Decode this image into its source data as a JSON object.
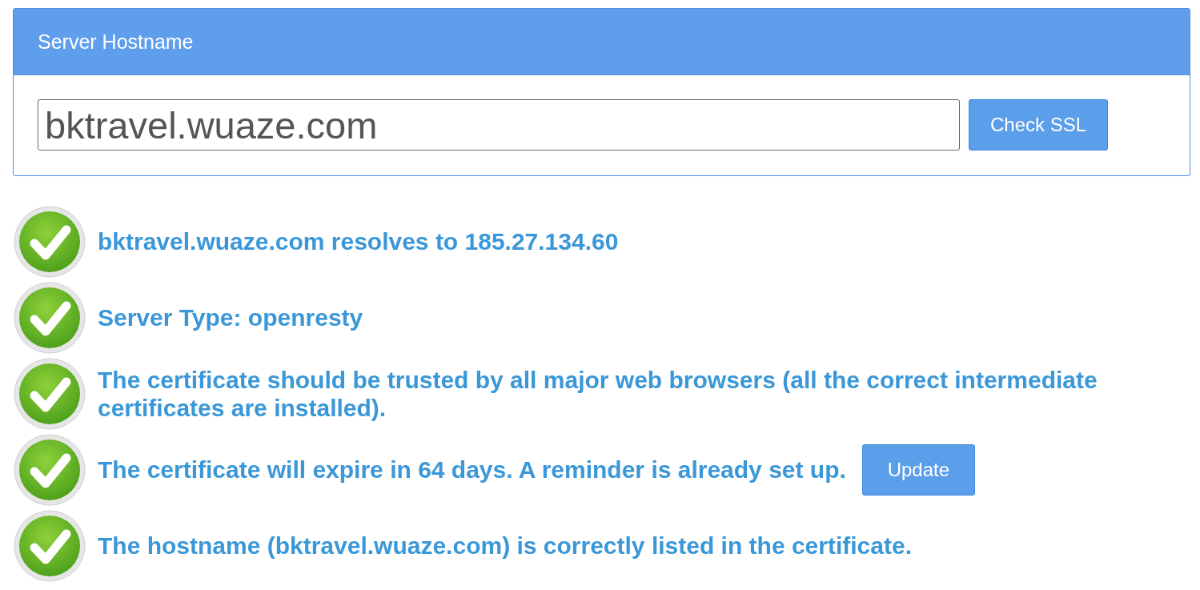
{
  "panel": {
    "title": "Server Hostname",
    "hostname": "bktravel.wuaze.com",
    "button": "Check SSL"
  },
  "results": [
    {
      "passed": true,
      "text": "bktravel.wuaze.com resolves to 185.27.134.60"
    },
    {
      "passed": true,
      "text": "Server Type: openresty"
    },
    {
      "passed": true,
      "text": "The certificate should be trusted by all major web browsers (all the correct intermediate certificates are installed)."
    },
    {
      "passed": true,
      "text": "The certificate will expire in 64 days. A reminder is already set up.",
      "button": "Update"
    },
    {
      "passed": true,
      "text": "The hostname (bktravel.wuaze.com) is correctly listed in the certificate."
    }
  ]
}
